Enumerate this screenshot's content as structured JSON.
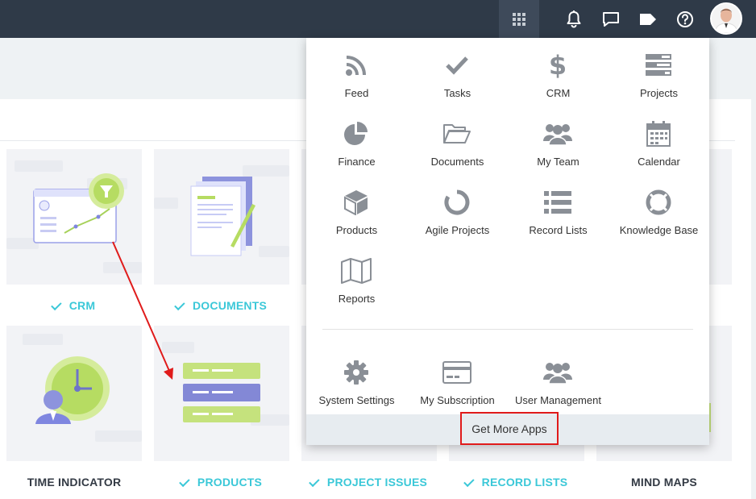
{
  "topbar": {
    "icons": [
      "apps-grid-icon",
      "bell-icon",
      "chat-icon",
      "tag-icon",
      "help-icon"
    ],
    "colors": {
      "bar": "#2f3a48",
      "active": "#3e4a5a"
    }
  },
  "tiles": [
    {
      "label": "CRM",
      "installed": true
    },
    {
      "label": "DOCUMENTS",
      "installed": true
    },
    {
      "label": "TIME INDICATOR",
      "installed": false
    },
    {
      "label": "PRODUCTS",
      "installed": true
    },
    {
      "label": "PROJECT ISSUES",
      "installed": true
    },
    {
      "label": "RECORD LISTS",
      "installed": true
    },
    {
      "label": "MIND MAPS",
      "installed": false
    }
  ],
  "apps_menu": {
    "apps": [
      {
        "label": "Feed",
        "icon": "rss-icon"
      },
      {
        "label": "Tasks",
        "icon": "checkmark-icon"
      },
      {
        "label": "CRM",
        "icon": "dollar-icon"
      },
      {
        "label": "Projects",
        "icon": "stacked-bars-icon"
      },
      {
        "label": "Finance",
        "icon": "pie-chart-icon"
      },
      {
        "label": "Documents",
        "icon": "folder-open-icon"
      },
      {
        "label": "My Team",
        "icon": "team-icon"
      },
      {
        "label": "Calendar",
        "icon": "calendar-icon"
      },
      {
        "label": "Products",
        "icon": "box-icon"
      },
      {
        "label": "Agile Projects",
        "icon": "ring-icon"
      },
      {
        "label": "Record Lists",
        "icon": "list-icon"
      },
      {
        "label": "Knowledge Base",
        "icon": "lifebuoy-icon"
      },
      {
        "label": "Reports",
        "icon": "map-icon"
      }
    ],
    "settings": [
      {
        "label": "System Settings",
        "icon": "gear-icon"
      },
      {
        "label": "My Subscription",
        "icon": "credit-card-icon"
      },
      {
        "label": "User Management",
        "icon": "users-icon"
      }
    ],
    "more_label": "Get More Apps",
    "icon_color": "#8a8f96",
    "highlight_color": "#e01b1b"
  }
}
